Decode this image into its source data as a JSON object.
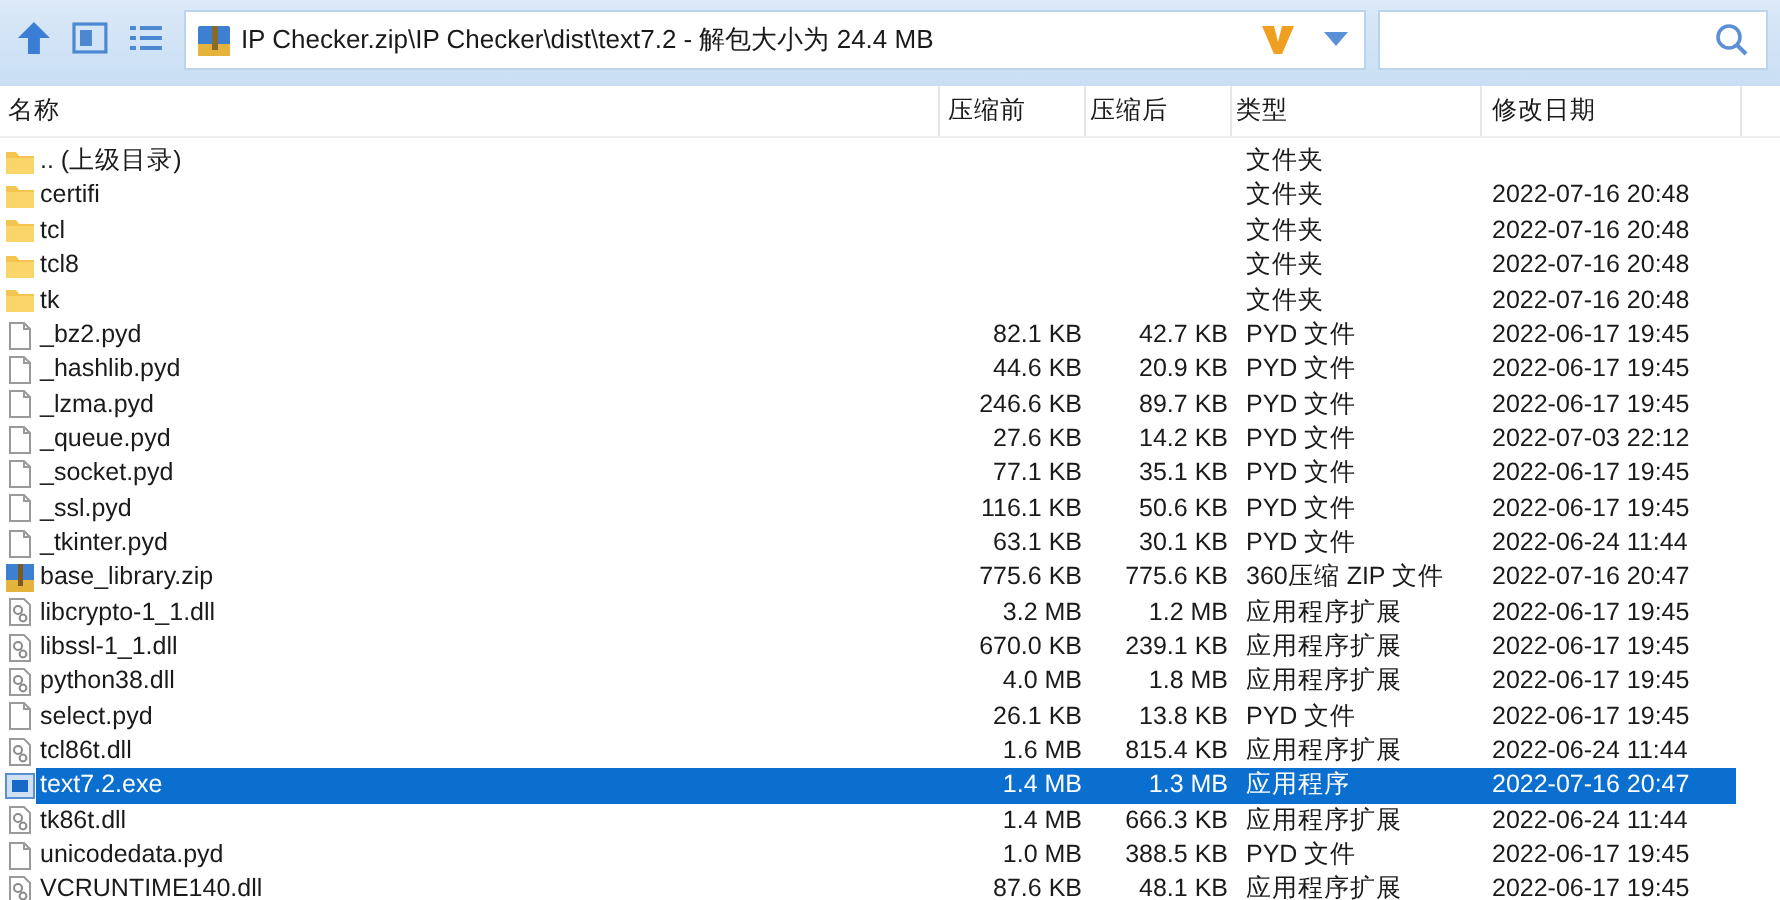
{
  "address_bar": {
    "path": "IP Checker.zip\\IP Checker\\dist\\text7.2 - 解包大小为 24.4 MB"
  },
  "columns": [
    "名称",
    "压缩前",
    "压缩后",
    "类型",
    "修改日期"
  ],
  "files": [
    {
      "kind": "folder",
      "name": ".. (上级目录)",
      "type": "文件夹",
      "selected": false
    },
    {
      "kind": "folder",
      "name": "certifi",
      "type": "文件夹",
      "modified": "2022-07-16 20:48",
      "selected": false
    },
    {
      "kind": "folder",
      "name": "tcl",
      "type": "文件夹",
      "modified": "2022-07-16 20:48",
      "selected": false
    },
    {
      "kind": "folder",
      "name": "tcl8",
      "type": "文件夹",
      "modified": "2022-07-16 20:48",
      "selected": false
    },
    {
      "kind": "folder",
      "name": "tk",
      "type": "文件夹",
      "modified": "2022-07-16 20:48",
      "selected": false
    },
    {
      "kind": "file",
      "name": "_bz2.pyd",
      "size": "82.1 KB",
      "packed": "42.7 KB",
      "type": "PYD 文件",
      "modified": "2022-06-17 19:45",
      "selected": false
    },
    {
      "kind": "file",
      "name": "_hashlib.pyd",
      "size": "44.6 KB",
      "packed": "20.9 KB",
      "type": "PYD 文件",
      "modified": "2022-06-17 19:45",
      "selected": false
    },
    {
      "kind": "file",
      "name": "_lzma.pyd",
      "size": "246.6 KB",
      "packed": "89.7 KB",
      "type": "PYD 文件",
      "modified": "2022-06-17 19:45",
      "selected": false
    },
    {
      "kind": "file",
      "name": "_queue.pyd",
      "size": "27.6 KB",
      "packed": "14.2 KB",
      "type": "PYD 文件",
      "modified": "2022-07-03 22:12",
      "selected": false
    },
    {
      "kind": "file",
      "name": "_socket.pyd",
      "size": "77.1 KB",
      "packed": "35.1 KB",
      "type": "PYD 文件",
      "modified": "2022-06-17 19:45",
      "selected": false
    },
    {
      "kind": "file",
      "name": "_ssl.pyd",
      "size": "116.1 KB",
      "packed": "50.6 KB",
      "type": "PYD 文件",
      "modified": "2022-06-17 19:45",
      "selected": false
    },
    {
      "kind": "file",
      "name": "_tkinter.pyd",
      "size": "63.1 KB",
      "packed": "30.1 KB",
      "type": "PYD 文件",
      "modified": "2022-06-24 11:44",
      "selected": false
    },
    {
      "kind": "zip",
      "name": "base_library.zip",
      "size": "775.6 KB",
      "packed": "775.6 KB",
      "type": "360压缩 ZIP 文件",
      "modified": "2022-07-16 20:47",
      "selected": false
    },
    {
      "kind": "dll",
      "name": "libcrypto-1_1.dll",
      "size": "3.2 MB",
      "packed": "1.2 MB",
      "type": "应用程序扩展",
      "modified": "2022-06-17 19:45",
      "selected": false
    },
    {
      "kind": "dll",
      "name": "libssl-1_1.dll",
      "size": "670.0 KB",
      "packed": "239.1 KB",
      "type": "应用程序扩展",
      "modified": "2022-06-17 19:45",
      "selected": false
    },
    {
      "kind": "dll",
      "name": "python38.dll",
      "size": "4.0 MB",
      "packed": "1.8 MB",
      "type": "应用程序扩展",
      "modified": "2022-06-17 19:45",
      "selected": false
    },
    {
      "kind": "file",
      "name": "select.pyd",
      "size": "26.1 KB",
      "packed": "13.8 KB",
      "type": "PYD 文件",
      "modified": "2022-06-17 19:45",
      "selected": false
    },
    {
      "kind": "dll",
      "name": "tcl86t.dll",
      "size": "1.6 MB",
      "packed": "815.4 KB",
      "type": "应用程序扩展",
      "modified": "2022-06-24 11:44",
      "selected": false
    },
    {
      "kind": "exe",
      "name": "text7.2.exe",
      "size": "1.4 MB",
      "packed": "1.3 MB",
      "type": "应用程序",
      "modified": "2022-07-16 20:47",
      "selected": true
    },
    {
      "kind": "dll",
      "name": "tk86t.dll",
      "size": "1.4 MB",
      "packed": "666.3 KB",
      "type": "应用程序扩展",
      "modified": "2022-06-24 11:44",
      "selected": false
    },
    {
      "kind": "file",
      "name": "unicodedata.pyd",
      "size": "1.0 MB",
      "packed": "388.5 KB",
      "type": "PYD 文件",
      "modified": "2022-06-17 19:45",
      "selected": false
    },
    {
      "kind": "dll",
      "name": "VCRUNTIME140.dll",
      "size": "87.6 KB",
      "packed": "48.1 KB",
      "type": "应用程序扩展",
      "modified": "2022-06-17 19:45",
      "selected": false
    }
  ]
}
